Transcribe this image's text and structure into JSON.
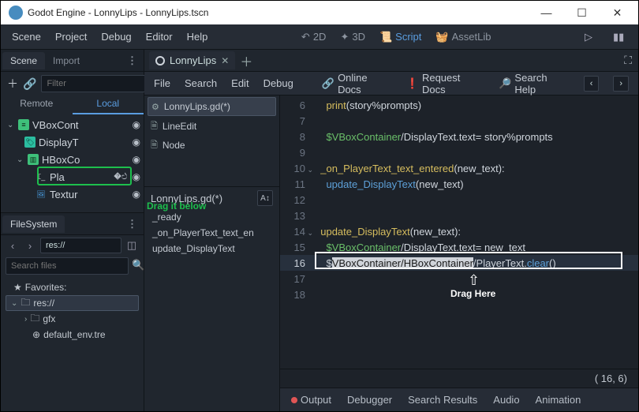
{
  "titlebar": {
    "title": "Godot Engine - LonnyLips - LonnyLips.tscn"
  },
  "menubar": {
    "scene": "Scene",
    "project": "Project",
    "debug": "Debug",
    "editor": "Editor",
    "help": "Help",
    "mode_2d": "2D",
    "mode_3d": "3D",
    "mode_script": "Script",
    "mode_assetlib": "AssetLib"
  },
  "left": {
    "scene_tab": "Scene",
    "import_tab": "Import",
    "filter_placeholder": "Filter",
    "remote": "Remote",
    "local": "Local",
    "tree": {
      "vboxcont": "VBoxCont",
      "displayt": "DisplayT",
      "hboxco": "HBoxCo",
      "pla": "Pla",
      "textur": "Textur"
    },
    "drag_below": "Drag it below",
    "fs_tab": "FileSystem",
    "path_value": "res://",
    "search_placeholder": "Search files",
    "favorites": "Favorites:",
    "res": "res://",
    "gfx": "gfx",
    "default_env": "default_env.tre"
  },
  "main": {
    "tab_name": "LonnyLips",
    "menu": {
      "file": "File",
      "search": "Search",
      "edit": "Edit",
      "debug": "Debug",
      "online_docs": "Online Docs",
      "request_docs": "Request Docs",
      "search_help": "Search Help"
    },
    "script_list": {
      "active": "LonnyLips.gd(*)",
      "lineedit": "LineEdit",
      "node": "Node",
      "method_header": "LonnyLips.gd(*)",
      "m1": "_ready",
      "m2": "_on_PlayerText_text_en",
      "m3": "update_DisplayText"
    },
    "status": "(  16,   6)",
    "drag_here": "Drag Here"
  },
  "code_lines": [
    {
      "n": "6",
      "segs": [
        [
          "    ",
          ""
        ],
        [
          "print",
          "yellow"
        ],
        [
          "(story%prompts)",
          "plain"
        ]
      ]
    },
    {
      "n": "7",
      "segs": [
        [
          "",
          ""
        ]
      ]
    },
    {
      "n": "8",
      "segs": [
        [
          "    ",
          ""
        ],
        [
          "$VBoxContainer",
          "green"
        ],
        [
          "/DisplayText.text= story%prompts",
          "plain"
        ]
      ]
    },
    {
      "n": "9",
      "segs": [
        [
          "",
          ""
        ]
      ]
    },
    {
      "n": "10",
      "fold": true,
      "segs": [
        [
          "  ",
          ""
        ],
        [
          "_on_PlayerText_text_entered",
          "yellow"
        ],
        [
          "(new_text):",
          "plain"
        ]
      ]
    },
    {
      "n": "11",
      "segs": [
        [
          "    ",
          ""
        ],
        [
          "update_DisplayText",
          "blue"
        ],
        [
          "(new_text)",
          "plain"
        ]
      ]
    },
    {
      "n": "12",
      "segs": [
        [
          "",
          ""
        ]
      ]
    },
    {
      "n": "13",
      "segs": [
        [
          "",
          ""
        ]
      ]
    },
    {
      "n": "14",
      "fold": true,
      "segs": [
        [
          "  ",
          ""
        ],
        [
          "update_DisplayText",
          "yellow"
        ],
        [
          "(new_text):",
          "plain"
        ]
      ]
    },
    {
      "n": "15",
      "segs": [
        [
          "    ",
          ""
        ],
        [
          "$VBoxContainer",
          "green"
        ],
        [
          "/DisplayText.text= new_text",
          "plain"
        ]
      ]
    },
    {
      "n": "16",
      "hl": true,
      "segs": [
        [
          "    ",
          ""
        ],
        [
          "$",
          "plain"
        ],
        [
          "VBoxContainer/HBoxContainer",
          "sel"
        ],
        [
          "/PlayerText.",
          "plain"
        ],
        [
          "clear",
          "blue"
        ],
        [
          "()",
          "plain"
        ]
      ]
    },
    {
      "n": "17",
      "segs": [
        [
          "",
          ""
        ]
      ]
    },
    {
      "n": "18",
      "segs": [
        [
          "",
          ""
        ]
      ]
    }
  ],
  "bottom": {
    "output": "Output",
    "debugger": "Debugger",
    "search_results": "Search Results",
    "audio": "Audio",
    "animation": "Animation"
  }
}
